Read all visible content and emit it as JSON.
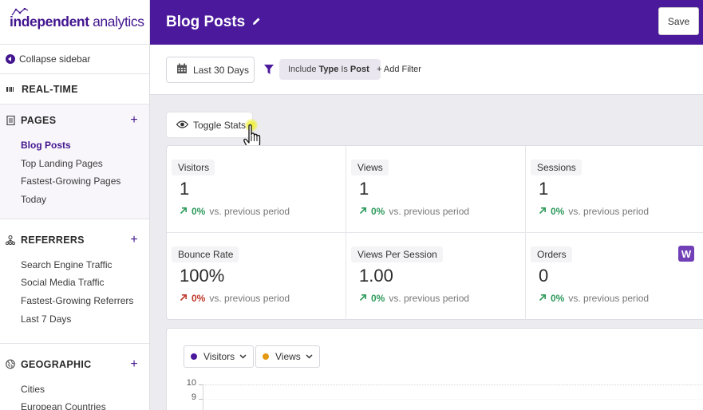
{
  "brand": {
    "logo_bold": "independent",
    "logo_light": " analytics",
    "accent": "#4b1a9c",
    "positive_color": "#2e9a5c",
    "negative_color": "#c0392b"
  },
  "sidebar": {
    "collapse_label": "Collapse sidebar",
    "realtime_label": "REAL-TIME",
    "sections": [
      {
        "title": "PAGES",
        "icon": "document-icon",
        "items": [
          "Blog Posts",
          "Top Landing Pages",
          "Fastest-Growing Pages",
          "Today"
        ],
        "current": "Blog Posts"
      },
      {
        "title": "REFERRERS",
        "icon": "network-icon",
        "items": [
          "Search Engine Traffic",
          "Social Media Traffic",
          "Fastest-Growing Referrers",
          "Last 7 Days"
        ]
      },
      {
        "title": "GEOGRAPHIC",
        "icon": "globe-icon",
        "items": [
          "Cities",
          "European Countries"
        ]
      }
    ]
  },
  "header": {
    "title": "Blog Posts",
    "save_label": "Save"
  },
  "filters": {
    "date_range": "Last 30 Days",
    "chip_prefix": "Include",
    "chip_field": "Type",
    "chip_op": "Is",
    "chip_value": "Post",
    "add_filter_label": "+ Add Filter"
  },
  "toggle_stats_label": "Toggle Stats",
  "stats": [
    {
      "label": "Visitors",
      "value": "1",
      "change": "0%",
      "trend": "up",
      "tone": "positive",
      "suffix": "vs. previous period"
    },
    {
      "label": "Views",
      "value": "1",
      "change": "0%",
      "trend": "up",
      "tone": "positive",
      "suffix": "vs. previous period"
    },
    {
      "label": "Sessions",
      "value": "1",
      "change": "0%",
      "trend": "up",
      "tone": "positive",
      "suffix": "vs. previous period"
    },
    {
      "label": "Bounce Rate",
      "value": "100%",
      "change": "0%",
      "trend": "up",
      "tone": "negative",
      "suffix": "vs. previous period"
    },
    {
      "label": "Views Per Session",
      "value": "1.00",
      "change": "0%",
      "trend": "up",
      "tone": "positive",
      "suffix": "vs. previous period"
    },
    {
      "label": "Orders",
      "value": "0",
      "change": "0%",
      "trend": "up",
      "tone": "positive",
      "suffix": "vs. previous period",
      "badge": "W"
    }
  ],
  "chart": {
    "series": [
      {
        "name": "Visitors",
        "color": "#4b1a9c"
      },
      {
        "name": "Views",
        "color": "#e39a12"
      }
    ],
    "y_ticks_visible": [
      "10",
      "9"
    ]
  }
}
